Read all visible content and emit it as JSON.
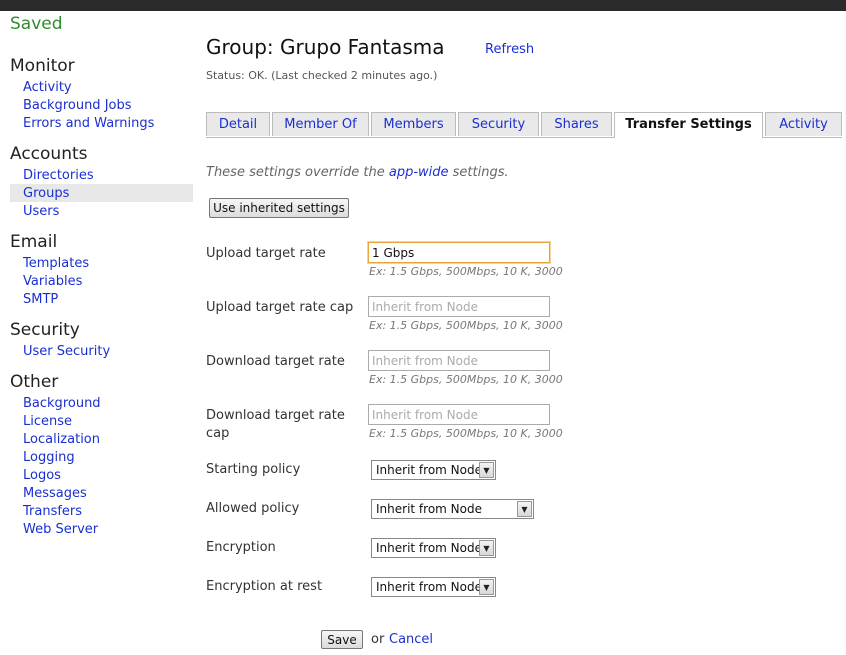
{
  "sidebar": {
    "saved": "Saved",
    "sections": [
      {
        "heading": "Monitor",
        "items": [
          "Activity",
          "Background Jobs",
          "Errors and Warnings"
        ]
      },
      {
        "heading": "Accounts",
        "items": [
          "Directories",
          "Groups",
          "Users"
        ]
      },
      {
        "heading": "Email",
        "items": [
          "Templates",
          "Variables",
          "SMTP"
        ]
      },
      {
        "heading": "Security",
        "items": [
          "User Security"
        ]
      },
      {
        "heading": "Other",
        "items": [
          "Background",
          "License",
          "Localization",
          "Logging",
          "Logos",
          "Messages",
          "Transfers",
          "Web Server"
        ]
      }
    ],
    "selected": "Groups"
  },
  "header": {
    "title": "Group: Grupo Fantasma",
    "refresh": "Refresh",
    "status": "Status: OK. (Last checked 2 minutes ago.)"
  },
  "tabs": [
    "Detail",
    "Member Of",
    "Members",
    "Security",
    "Shares",
    "Transfer Settings",
    "Activity"
  ],
  "active_tab": "Transfer Settings",
  "note": {
    "prefix": "These settings override the ",
    "link": "app-wide",
    "suffix": " settings."
  },
  "inherit_button": "Use inherited settings",
  "fields": {
    "upload_rate": {
      "label": "Upload target rate",
      "value": "1 Gbps",
      "placeholder": "",
      "hint": "Ex: 1.5 Gbps, 500Mbps, 10 K, 3000"
    },
    "upload_cap": {
      "label": "Upload target rate cap",
      "value": "",
      "placeholder": "Inherit from Node",
      "hint": "Ex: 1.5 Gbps, 500Mbps, 10 K, 3000"
    },
    "download_rate": {
      "label": "Download target rate",
      "value": "",
      "placeholder": "Inherit from Node",
      "hint": "Ex: 1.5 Gbps, 500Mbps, 10 K, 3000"
    },
    "download_cap": {
      "label": "Download target rate cap",
      "value": "",
      "placeholder": "Inherit from Node",
      "hint": "Ex: 1.5 Gbps, 500Mbps, 10 K, 3000"
    }
  },
  "selects": {
    "starting_policy": {
      "label": "Starting policy",
      "value": "Inherit from Node"
    },
    "allowed_policy": {
      "label": "Allowed policy",
      "value": "Inherit from Node"
    },
    "encryption": {
      "label": "Encryption",
      "value": "Inherit from Node"
    },
    "encryption_at_rest": {
      "label": "Encryption at rest",
      "value": "Inherit from Node"
    }
  },
  "footer": {
    "save": "Save",
    "or": "or",
    "cancel": "Cancel"
  },
  "colors": {
    "link": "#1a2fd0",
    "saved": "#2e8b2e",
    "focus": "#e8a33a"
  }
}
